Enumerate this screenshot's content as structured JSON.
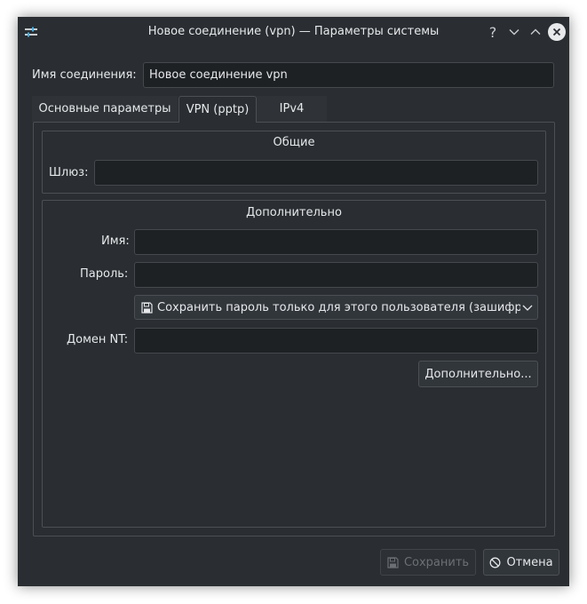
{
  "window": {
    "title": "Новое соединение (vpn) — Параметры системы",
    "help_glyph": "?"
  },
  "connection": {
    "name_label": "Имя соединения:",
    "name_value": "Новое соединение vpn"
  },
  "tabs": [
    {
      "label": "Основные параметры",
      "active": false
    },
    {
      "label": "VPN (pptp)",
      "active": true
    },
    {
      "label": "IPv4",
      "active": false
    }
  ],
  "general": {
    "title": "Общие",
    "gateway_label": "Шлюз:",
    "gateway_value": ""
  },
  "optional": {
    "title": "Дополнительно",
    "login_label": "Имя:",
    "login_value": "",
    "password_label": "Пароль:",
    "password_value": "",
    "password_mode": "Сохранить пароль только для этого пользователя (зашифр",
    "nt_domain_label": "Домен NT:",
    "nt_domain_value": "",
    "advanced_button": "Дополнительно..."
  },
  "footer": {
    "save_button": "Сохранить",
    "save_enabled": false,
    "cancel_button": "Отмена"
  },
  "colors": {
    "window_bg": "#2a2e32",
    "field_bg": "#1e2124",
    "border": "#4c5055",
    "text": "#e6e8ea"
  }
}
